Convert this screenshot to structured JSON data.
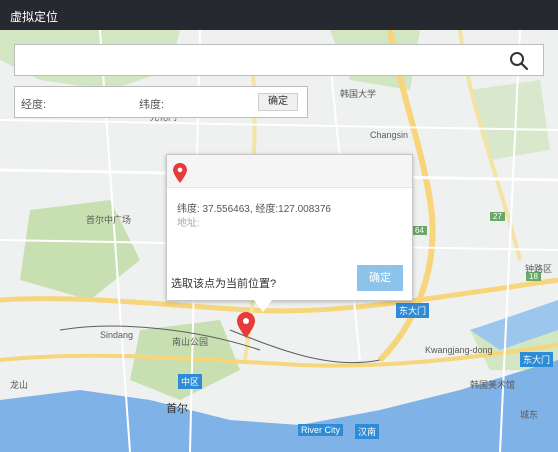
{
  "window": {
    "title": "虚拟定位"
  },
  "search": {
    "value": "",
    "placeholder": ""
  },
  "coord_bar": {
    "lat_label": "经度:",
    "lon_label": "纬度:",
    "confirm_label": "确定"
  },
  "popup": {
    "coords": "纬度: 37.556463, 经度:127.008376",
    "address": "地址:",
    "question": "选取该点为当前位置?",
    "confirm_label": "确定"
  },
  "map_labels": {
    "main_road": "中区",
    "city": "首尔",
    "park": "南山公园",
    "district_east": "东大门",
    "district_jongno": "钟路区",
    "university": "韩国大学",
    "changwon": "Changsin",
    "square": "首尔中广场",
    "gwanghwamun": "光化门",
    "dongdaemun_station": "东大门",
    "kwangjang": "Kwangjang-dong",
    "sindang": "Sindang",
    "city_river": "River City",
    "hannam": "汉南",
    "yongsan": "龙山",
    "hanbuk": "韩国美术馆",
    "seongdong": "城东",
    "road_64": "64",
    "road_27": "27",
    "road_18": "18"
  },
  "colors": {
    "titlebar": "#262a30",
    "water": "#7fb3e8",
    "park": "#c8e0b1",
    "road_main": "#f7d57a",
    "confirm": "#8dc3ea",
    "pin": "#e63b3b"
  },
  "icons": {
    "search": "search-icon",
    "pin": "map-pin-icon",
    "popup_pin": "map-pin-icon"
  }
}
